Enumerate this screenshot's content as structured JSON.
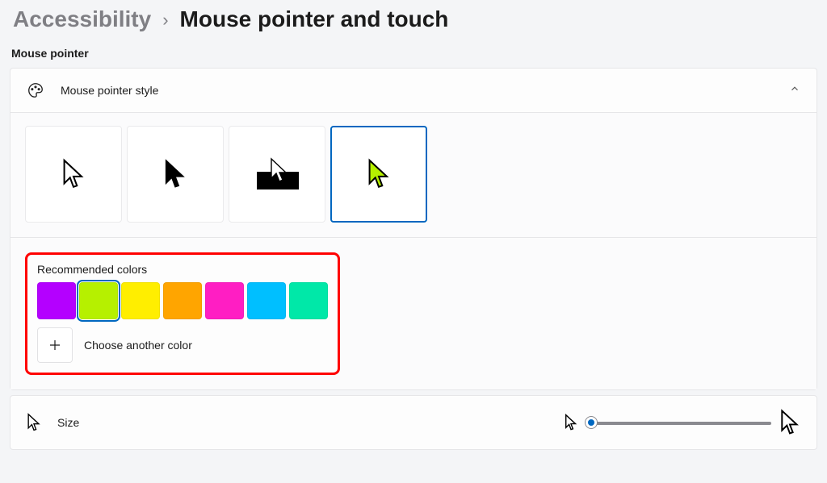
{
  "breadcrumb": {
    "parent": "Accessibility",
    "current": "Mouse pointer and touch"
  },
  "section_label": "Mouse pointer",
  "style_card": {
    "title": "Mouse pointer style",
    "selected_index": 3,
    "options": [
      {
        "kind": "white"
      },
      {
        "kind": "black"
      },
      {
        "kind": "inverted"
      },
      {
        "kind": "custom",
        "color": "#b6f000"
      }
    ]
  },
  "colors": {
    "title": "Recommended colors",
    "selected_index": 1,
    "swatches": [
      "#b400ff",
      "#b6f000",
      "#ffee00",
      "#ffa500",
      "#ff1ec3",
      "#00bfff",
      "#00e8a8"
    ],
    "choose_label": "Choose another color"
  },
  "size_card": {
    "title": "Size",
    "value_pct": 0
  }
}
